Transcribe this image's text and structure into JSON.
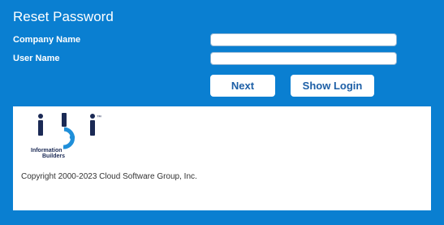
{
  "form": {
    "title": "Reset Password",
    "company_label": "Company Name",
    "company_value": "",
    "user_label": "User Name",
    "user_value": "",
    "next_label": "Next",
    "show_login_label": "Show Login"
  },
  "footer": {
    "logo_name": "ibi-logo",
    "logo_line1": "Information",
    "logo_line2": "Builders",
    "trademark": "™",
    "copyright": "Copyright 2000-2023 Cloud Software Group, Inc."
  },
  "colors": {
    "background": "#0a7fd1",
    "panel": "#ffffff",
    "button_text": "#1d5fa6",
    "logo_navy": "#1b2a55",
    "logo_blue": "#1f8fd9"
  }
}
